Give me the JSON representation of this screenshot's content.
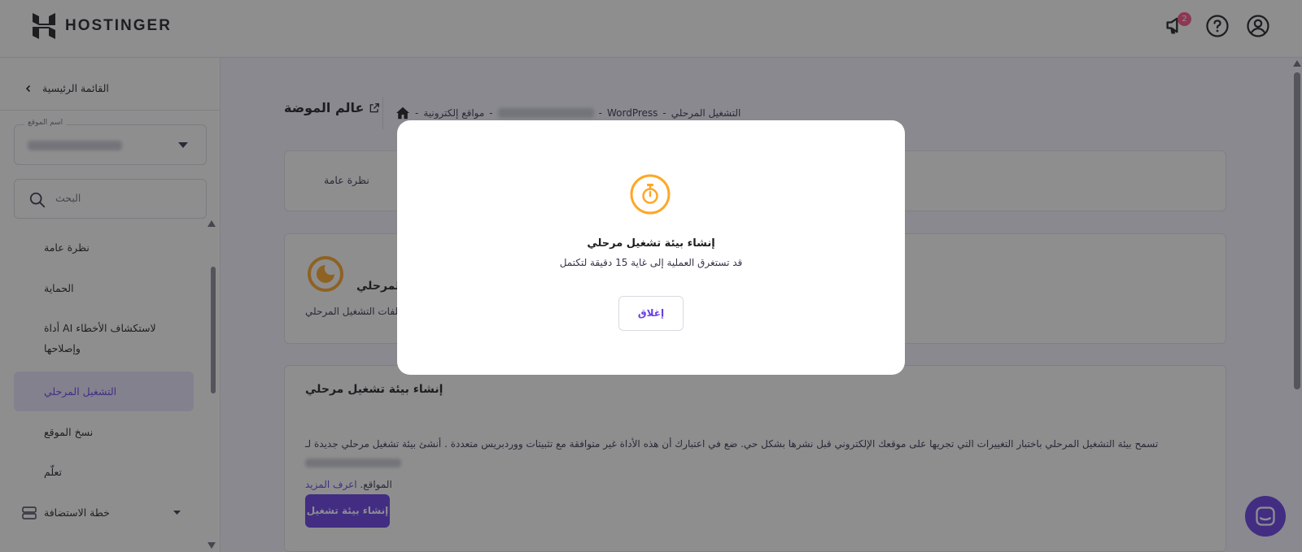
{
  "header": {
    "brand": "HOSTINGER",
    "notification_count": "2",
    "icons": [
      "megaphone-icon",
      "help-icon",
      "user-account-icon"
    ]
  },
  "sidebar": {
    "back_label": "القائمة الرئيسية",
    "site_select_label": "اسم الموقع",
    "search_placeholder": "البحث",
    "items": [
      {
        "label": "نظرة عامة"
      },
      {
        "label": "الحماية"
      },
      {
        "label": "أداة AI لاستكشاف الأخطاء وإصلاحها"
      },
      {
        "label": "التشغيل المرحلي"
      },
      {
        "label": "نسخ الموقع"
      },
      {
        "label": "تعلّم"
      },
      {
        "label": "خطة الاستضافة"
      }
    ],
    "active_item": "التشغيل المرحلي"
  },
  "main": {
    "page_title": "عالم الموضة",
    "breadcrumb": {
      "staging": "التشغيل المرحلي",
      "wordpress": "WordPress",
      "websites": "مواقع إلكترونية"
    },
    "tab_overview": "نظرة عامة",
    "staging_card": {
      "title": "المرحلي",
      "desc": "ملفات التشغيل المرحلي"
    },
    "create_card": {
      "title": "إنشاء بيئة تشغيل مرحلي",
      "desc": "تسمح بيئة التشغيل المرحلي باختبار التغييرات التي تجريها على موقعك الإلكتروني قبل نشرها بشكل حي. ضع في اعتبارك أن هذه الأداة غير متوافقة مع تثبيتات ووردبريس متعددة . أنشئ بيئة تشغيل مرحلي جديدة لـ",
      "desc2": "المواقع.",
      "learn_more": "اعرف المزيد",
      "button": "إنشاء بيئة تشغيل"
    }
  },
  "modal": {
    "title": "إنشاء بيئة تشغيل مرحلي",
    "subtitle": "قد تستغرق العملية إلى غاية 15 دقيقة لتكتمل",
    "close_button": "إغلاق",
    "icon": "stopwatch-icon",
    "accent": "#ffa726"
  },
  "colors": {
    "brand": "#673de6",
    "overlay": "#1d1e20"
  }
}
